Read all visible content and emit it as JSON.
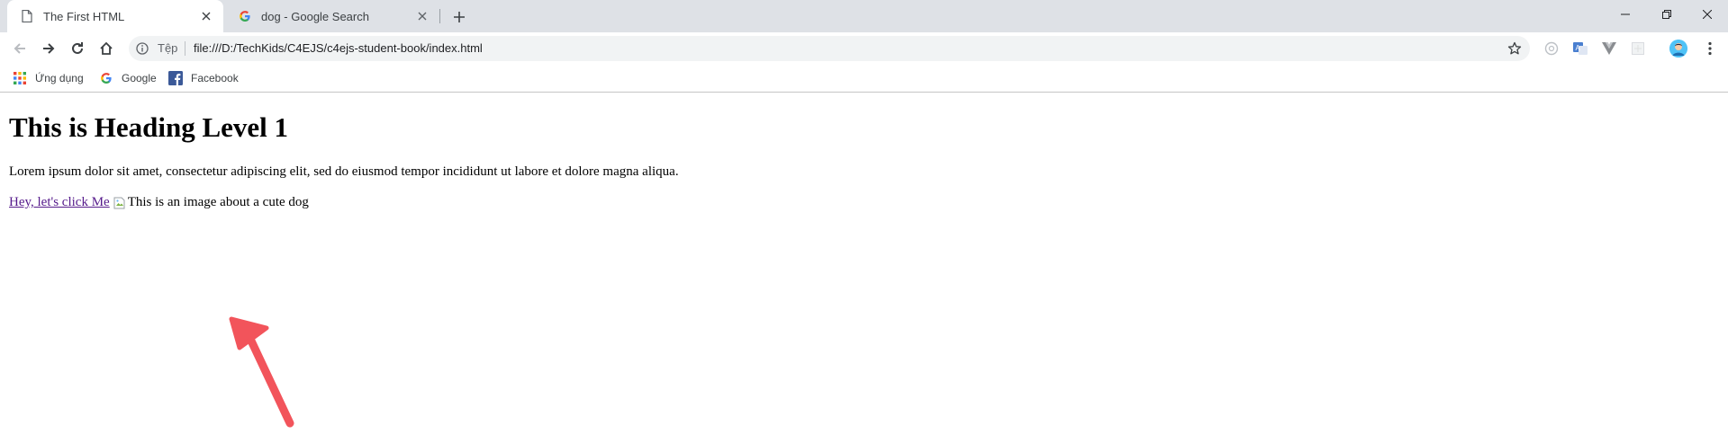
{
  "tabs": [
    {
      "title": "The First HTML",
      "active": true,
      "icon": "document-icon"
    },
    {
      "title": "dog - Google Search",
      "active": false,
      "icon": "google-g-icon"
    }
  ],
  "address_bar": {
    "security_chip": "Tệp",
    "url": "file:///D:/TechKids/C4EJS/c4ejs-student-book/index.html"
  },
  "bookmarks": [
    {
      "label": "Ứng dụng",
      "icon": "apps-grid-icon"
    },
    {
      "label": "Google",
      "icon": "google-g-icon"
    },
    {
      "label": "Facebook",
      "icon": "facebook-icon"
    }
  ],
  "page": {
    "heading": "This is Heading Level 1",
    "paragraph": "Lorem ipsum dolor sit amet, consectetur adipiscing elit, sed do eiusmod tempor incididunt ut labore et dolore magna aliqua.",
    "link_text": "Hey, let's click Me",
    "image_alt": "This is an image about a cute dog"
  },
  "colors": {
    "tabstrip_bg": "#dee1e6",
    "link_visited": "#551a8b",
    "annotation_arrow": "#f2545b"
  }
}
